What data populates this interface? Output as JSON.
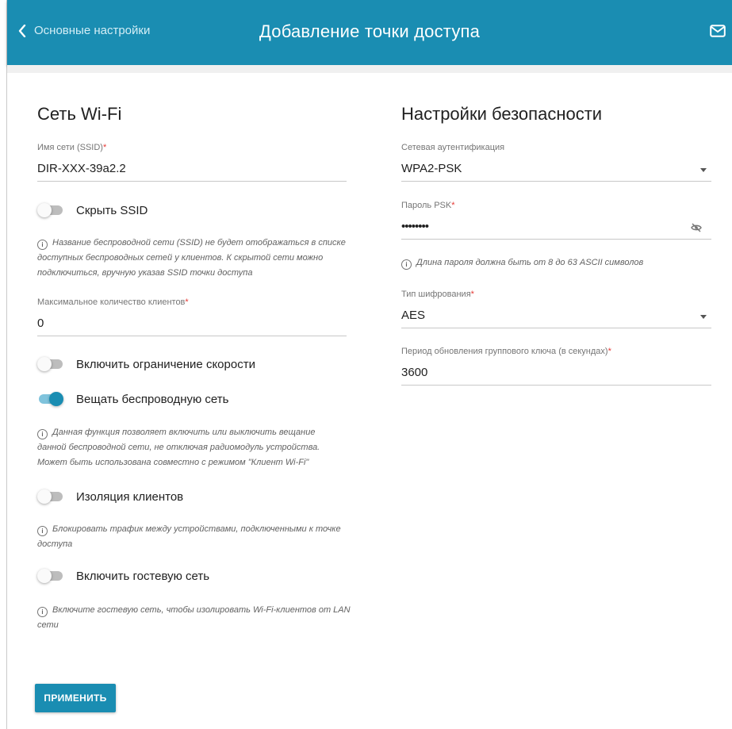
{
  "header": {
    "back_label": "Основные настройки",
    "title": "Добавление точки доступа"
  },
  "wifi": {
    "section_title": "Сеть Wi-Fi",
    "ssid": {
      "label": "Имя сети (SSID)",
      "required": "*",
      "value": "DIR-XXX-39a2.2"
    },
    "hide_ssid": {
      "label": "Скрыть SSID",
      "on": false
    },
    "hide_ssid_hint": "Название беспроводной сети (SSID) не будет отображаться в списке доступных беспроводных сетей у клиентов. К скрытой сети можно подключиться, вручную указав SSID точки доступа",
    "max_clients": {
      "label": "Максимальное количество клиентов",
      "required": "*",
      "value": "0"
    },
    "speed_limit": {
      "label": "Включить ограничение скорости",
      "on": false
    },
    "broadcast": {
      "label": "Вещать беспроводную сеть",
      "on": true
    },
    "broadcast_hint": "Данная функция позволяет включить или выключить вещание данной беспроводной сети, не отключая радиомодуль устройства. Может быть использована совместно с режимом \"Клиент Wi-Fi\"",
    "isolation": {
      "label": "Изоляция клиентов",
      "on": false
    },
    "isolation_hint": "Блокировать трафик между устройствами, подключенными к точке доступа",
    "guest": {
      "label": "Включить гостевую сеть",
      "on": false
    },
    "guest_hint": "Включите гостевую сеть, чтобы изолировать Wi-Fi-клиентов от LAN сети"
  },
  "security": {
    "section_title": "Настройки безопасности",
    "auth": {
      "label": "Сетевая аутентификация",
      "value": "WPA2-PSK"
    },
    "psk": {
      "label": "Пароль PSK",
      "required": "*",
      "value": "••••••••"
    },
    "psk_hint": "Длина пароля должна быть от 8 до 63 ASCII символов",
    "encryption": {
      "label": "Тип шифрования",
      "required": "*",
      "value": "AES"
    },
    "rekey": {
      "label": "Период обновления группового ключа (в секундах)",
      "required": "*",
      "value": "3600"
    }
  },
  "actions": {
    "apply_label": "ПРИМЕНИТЬ"
  },
  "icons": {
    "back": "chevron-left-icon",
    "mail": "mail-icon",
    "eye": "eye-off-icon",
    "info": "info-icon",
    "dropdown": "caret-down-icon"
  },
  "colors": {
    "accent": "#1a8db2",
    "required": "#e53935"
  }
}
